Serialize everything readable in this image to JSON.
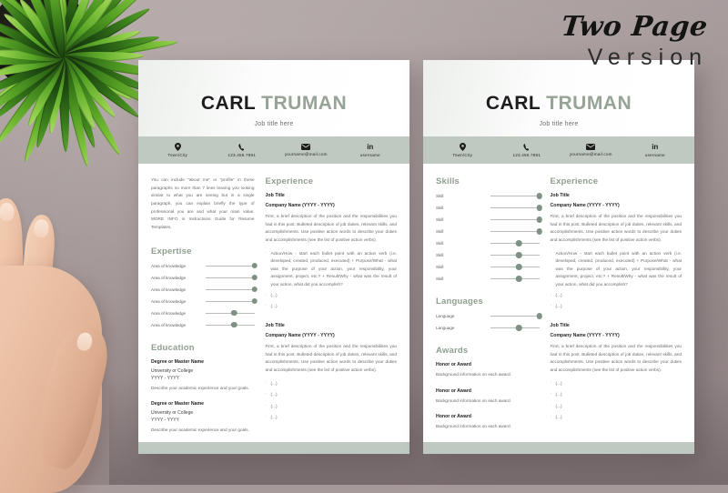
{
  "headline": {
    "line1": "Two Page",
    "line2": "Version"
  },
  "colors": {
    "sage": "#bfc9c2",
    "sage_text": "#8fa08f",
    "name_accent": "#96a396",
    "slider_dot": "#7e9184",
    "background": "#a79a9a"
  },
  "resume": {
    "name_first": "CARL",
    "name_last": "TRUMAN",
    "job_title": "Job title here",
    "contact": [
      {
        "icon": "location-pin-icon",
        "text": "Town/City"
      },
      {
        "icon": "phone-icon",
        "text": "123.456.7891"
      },
      {
        "icon": "envelope-icon",
        "text": "yourname@mail.com"
      },
      {
        "icon": "linkedin-icon",
        "text": "username"
      }
    ],
    "profile_text": "You can include \"about me\" or \"profile\" in these paragraphs no more than 7 lines leaving you looking similar to what you are seeing but in a single paragraph, you can explain briefly the type of professional you are and what your main value. MORE INFO in Instructions Guide for Resume Templates.",
    "expertise": {
      "title": "Expertise",
      "items": [
        {
          "label": "Area of knowledge",
          "value": 100
        },
        {
          "label": "Area of knowledge",
          "value": 100
        },
        {
          "label": "Area of knowledge",
          "value": 100
        },
        {
          "label": "Area of knowledge",
          "value": 100
        },
        {
          "label": "Area of knowledge",
          "value": 58
        },
        {
          "label": "Area of knowledge",
          "value": 58
        }
      ]
    },
    "education": {
      "title": "Education",
      "entries": [
        {
          "degree": "Degree or Master Name",
          "school": "University or College",
          "dates": "YYYY - YYYY",
          "description": "Describe your academic experience and your goals."
        },
        {
          "degree": "Degree or Master Name",
          "school": "University or College",
          "dates": "YYYY - YYYY",
          "description": "Describe your academic experience and your goals."
        }
      ]
    },
    "skills": {
      "title": "Skills",
      "items": [
        {
          "label": "Skill",
          "value": 100
        },
        {
          "label": "Skill",
          "value": 100
        },
        {
          "label": "Skill",
          "value": 100
        },
        {
          "label": "Skill",
          "value": 100
        },
        {
          "label": "Skill",
          "value": 58
        },
        {
          "label": "Skill",
          "value": 58
        },
        {
          "label": "Skill",
          "value": 58
        },
        {
          "label": "Skill",
          "value": 58
        }
      ]
    },
    "languages": {
      "title": "Languages",
      "items": [
        {
          "label": "Language",
          "value": 100
        },
        {
          "label": "Language",
          "value": 58
        }
      ]
    },
    "awards": {
      "title": "Awards",
      "entries": [
        {
          "name": "Honor or Award",
          "description": "Background information on each award."
        },
        {
          "name": "Honor or Award",
          "description": "Background information on each award."
        },
        {
          "name": "Honor or Award",
          "description": "Background information on each award."
        }
      ]
    },
    "experience": {
      "title": "Experience",
      "job_title": "Job Title",
      "company": "Company Name (YYYY - YYYY)",
      "description": "First, a brief description of the position and the responsibilities you had in this post. Bulleted description of job duties, relevant skills, and accomplishments. Use positive action words to describe your duties and accomplishments (see the list of positive action verbs).",
      "bullet_long": "Action/How - start each bullet point with an action verb (i.e. developed, created, produced, executed) + Purpose/What - what was the purpose of your action, your responsibility, your assignment, project, etc.? + Result/Why - what was the result of your action, what did you accomplish?",
      "bullet_placeholder": "(...)"
    }
  }
}
